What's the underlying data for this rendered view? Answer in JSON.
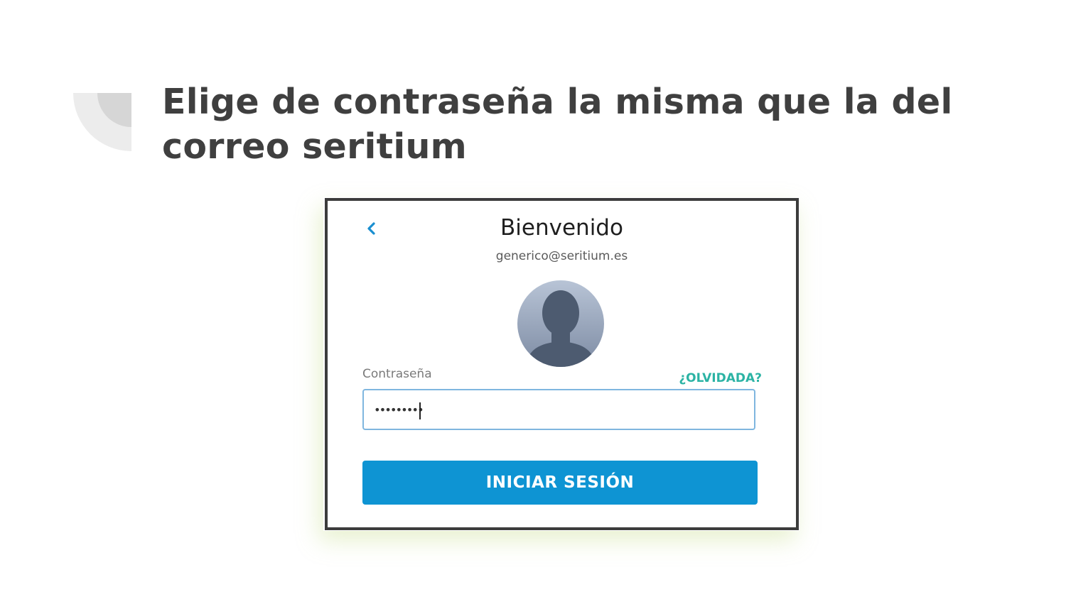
{
  "slide": {
    "title": "Elige de contraseña la misma que la del correo seritium"
  },
  "login": {
    "back_icon": "chevron-left-icon",
    "heading": "Bienvenido",
    "email": "generico@seritium.es",
    "avatar_icon": "user-silhouette-icon",
    "password_label": "Contraseña",
    "forgot_link": "¿OLVIDADA?",
    "password_value": "•••••••••",
    "submit_label": "INICIAR SESIÓN"
  },
  "colors": {
    "title_text": "#3f3f3f",
    "accent_blue": "#0e94d3",
    "link_teal": "#2bb3a4",
    "input_border": "#7fb6df",
    "frame_border": "#3c3c3c"
  }
}
